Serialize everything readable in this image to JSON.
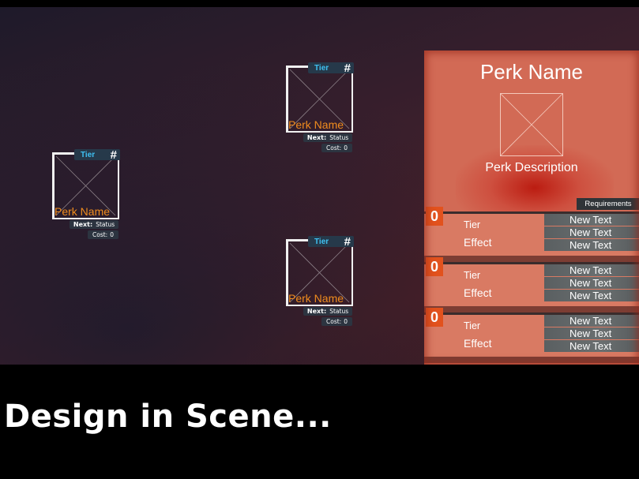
{
  "nodes": [
    {
      "tier_label": "Tier",
      "tier_value": "#",
      "name": "Perk Name",
      "next_label": "Next:",
      "next_value": "Status",
      "cost_label": "Cost:",
      "cost_value": "0"
    },
    {
      "tier_label": "Tier",
      "tier_value": "#",
      "name": "Perk Name",
      "next_label": "Next:",
      "next_value": "Status",
      "cost_label": "Cost:",
      "cost_value": "0"
    },
    {
      "tier_label": "Tier",
      "tier_value": "#",
      "name": "Perk Name",
      "next_label": "Next:",
      "next_value": "Status",
      "cost_label": "Cost:",
      "cost_value": "0"
    }
  ],
  "panel": {
    "title": "Perk Name",
    "description": "Perk Description",
    "requirements_label": "Requirements",
    "tiers": [
      {
        "level": "0",
        "tier_label": "Tier",
        "effect_label": "Effect",
        "texts": [
          "New Text",
          "New Text",
          "New Text"
        ]
      },
      {
        "level": "0",
        "tier_label": "Tier",
        "effect_label": "Effect",
        "texts": [
          "New Text",
          "New Text",
          "New Text"
        ]
      },
      {
        "level": "0",
        "tier_label": "Tier",
        "effect_label": "Effect",
        "texts": [
          "New Text",
          "New Text",
          "New Text"
        ]
      }
    ]
  },
  "caption": "Design in Scene...",
  "colors": {
    "tier": "#3fc1f2",
    "perk_name": "#f08c1e",
    "panel": "#d26a55",
    "badge": "#e2521d"
  }
}
